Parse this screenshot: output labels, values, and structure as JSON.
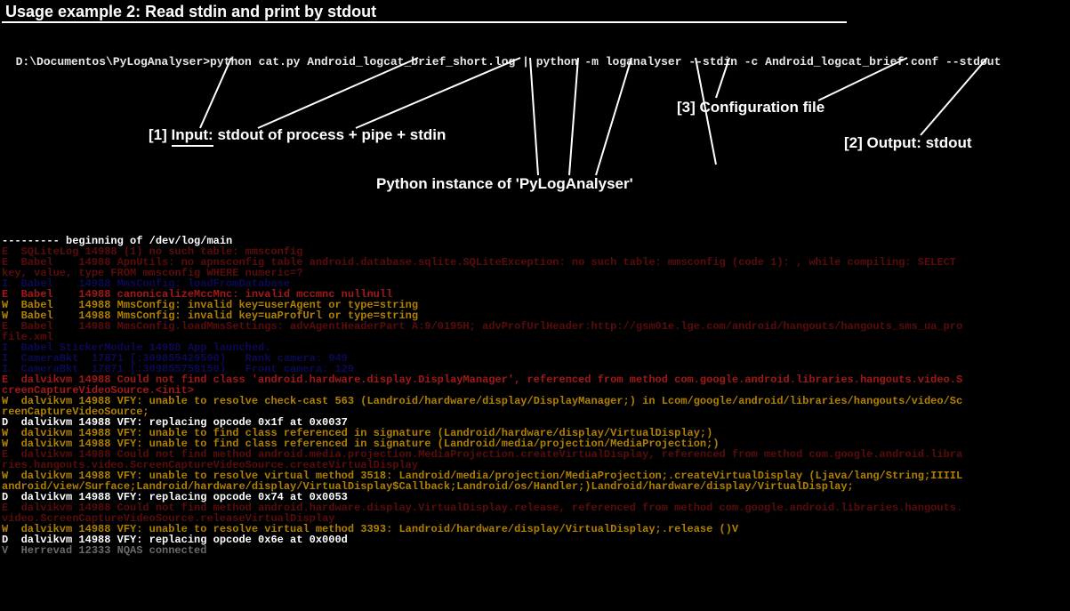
{
  "title": "Usage example 2: Read stdin and print by stdout",
  "prompt": "D:\\Documentos\\PyLogAnalyser>",
  "command": "python cat.py Android_logcat_brief_short.log | python -m loganalyser --stdin -c Android_logcat_brief.conf --stdout",
  "annotations": {
    "input_num": "[1]",
    "input_word": "Input:",
    "input_rest": " stdout of process + pipe + stdin",
    "config": "[3] Configuration file",
    "output": "[2] Output: stdout",
    "python": "Python instance of 'PyLogAnalyser'"
  },
  "log": {
    "l00": "--------- beginning of /dev/log/main",
    "l01": "E  SQLiteLog 14988 (1) no such table: mmsconfig",
    "l02": "E  Babel    14988 ApnUtils: no apnsconfig table android.database.sqlite.SQLiteException: no such table: mmsconfig (code 1): , while compiling: SELECT",
    "l03": "key, value, type FROM mmsconfig WHERE numeric=?",
    "l04": "I  Babel    14988 MmsConfig: loadFromDatabase",
    "l05": "E  Babel    14988 canonicalizeMccMnc: invalid mccmnc nullnull",
    "l06": "W  Babel    14988 MmsConfig: invalid key=userAgent or type=string",
    "l07": "W  Babel    14988 MmsConfig: invalid key=uaProfUrl or type=string",
    "l08": "E  Babel    14988 MmsConfig.loadMmsSettings: advAgentHeaderPart A:9/0195H; advProfUrlHeader:http://gsm01e.lge.com/android/hangouts/hangouts_sms_ua_pro",
    "l09": "file.xml",
    "l10": "I  Babel_StickerModule 14988 App launched.",
    "l11": "I  CameraBkt  17871 [:309855429590)   Rank camera: 949",
    "l12": "I  CameraBkt  17871 [:309855758150)   Front camera: 129",
    "l13": "E  dalvikvm 14988 Could not find class 'android.hardware.display.DisplayManager', referenced from method com.google.android.libraries.hangouts.video.S",
    "l14": "creenCaptureVideoSource.<init>",
    "l15": "W  dalvikvm 14988 VFY: unable to resolve check-cast 563 (Landroid/hardware/display/DisplayManager;) in Lcom/google/android/libraries/hangouts/video/Sc",
    "l16": "reenCaptureVideoSource;",
    "l17": "D  dalvikvm 14988 VFY: replacing opcode 0x1f at 0x0037",
    "l18": "W  dalvikvm 14988 VFY: unable to find class referenced in signature (Landroid/hardware/display/VirtualDisplay;)",
    "l19": "W  dalvikvm 14988 VFY: unable to find class referenced in signature (Landroid/media/projection/MediaProjection;)",
    "l20": "E  dalvikvm 14988 Could not find method android.media.projection.MediaProjection.createVirtualDisplay, referenced from method com.google.android.libra",
    "l21": "ries.hangouts.video.ScreenCaptureVideoSource.createVirtualDisplay",
    "l22": "W  dalvikvm 14988 VFY: unable to resolve virtual method 3518: Landroid/media/projection/MediaProjection;.createVirtualDisplay (Ljava/lang/String;IIIIL",
    "l23": "android/view/Surface;Landroid/hardware/display/VirtualDisplay$Callback;Landroid/os/Handler;)Landroid/hardware/display/VirtualDisplay;",
    "l24": "D  dalvikvm 14988 VFY: replacing opcode 0x74 at 0x0053",
    "l25": "E  dalvikvm 14988 Could not find method android.hardware.display.VirtualDisplay.release, referenced from method com.google.android.libraries.hangouts.",
    "l26": "video.ScreenCaptureVideoSource.releaseVirtualDisplay",
    "l27": "W  dalvikvm 14988 VFY: unable to resolve virtual method 3393: Landroid/hardware/display/VirtualDisplay;.release ()V",
    "l28": "D  dalvikvm 14988 VFY: replacing opcode 0x6e at 0x000d",
    "l29": "V  Herrevad 12333 NQAS connected"
  }
}
